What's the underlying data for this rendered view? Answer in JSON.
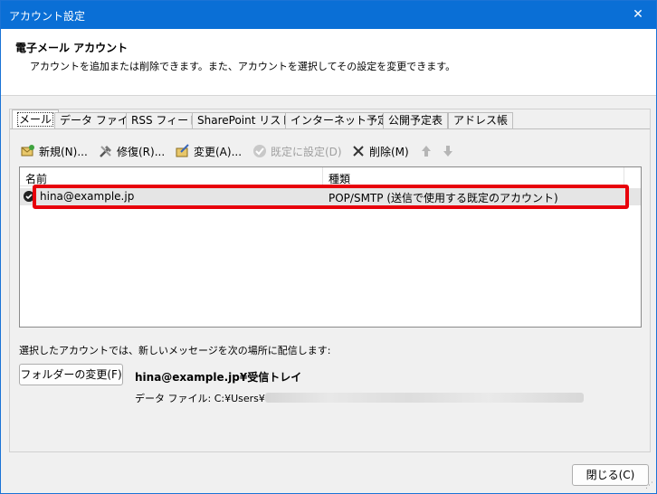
{
  "window": {
    "title": "アカウント設定",
    "close_glyph": "✕"
  },
  "header": {
    "title": "電子メール アカウント",
    "description": "アカウントを追加または削除できます。また、アカウントを選択してその設定を変更できます。"
  },
  "tabs": [
    {
      "label": "メール",
      "active": true
    },
    {
      "label": "データ ファイル"
    },
    {
      "label": "RSS フィード"
    },
    {
      "label": "SharePoint リスト"
    },
    {
      "label": "インターネット予定表"
    },
    {
      "label": "公開予定表"
    },
    {
      "label": "アドレス帳"
    }
  ],
  "toolbar": {
    "new_label": "新規(N)...",
    "repair_label": "修復(R)...",
    "change_label": "変更(A)...",
    "set_default_label": "既定に設定(D)",
    "delete_label": "削除(M)"
  },
  "list": {
    "col_name": "名前",
    "col_type": "種類",
    "rows": [
      {
        "name": "hina@example.jp",
        "type": "POP/SMTP (送信で使用する既定のアカウント)"
      }
    ]
  },
  "delivery": {
    "description": "選択したアカウントでは、新しいメッセージを次の場所に配信します:",
    "folder_button": "フォルダーの変更(F)",
    "location": "hina@example.jp¥受信トレイ",
    "datafile_prefix": "データ ファイル: C:¥Users¥"
  },
  "footer": {
    "close_label": "閉じる(C)"
  },
  "icons": {
    "new": "new-account-icon",
    "repair": "repair-tools-icon",
    "change": "change-settings-icon",
    "set_default": "default-check-icon",
    "delete": "delete-x-icon",
    "move_up": "arrow-up-icon",
    "move_down": "arrow-down-icon"
  },
  "colors": {
    "titlebar": "#0a6fd6",
    "highlight": "#e8000b"
  }
}
